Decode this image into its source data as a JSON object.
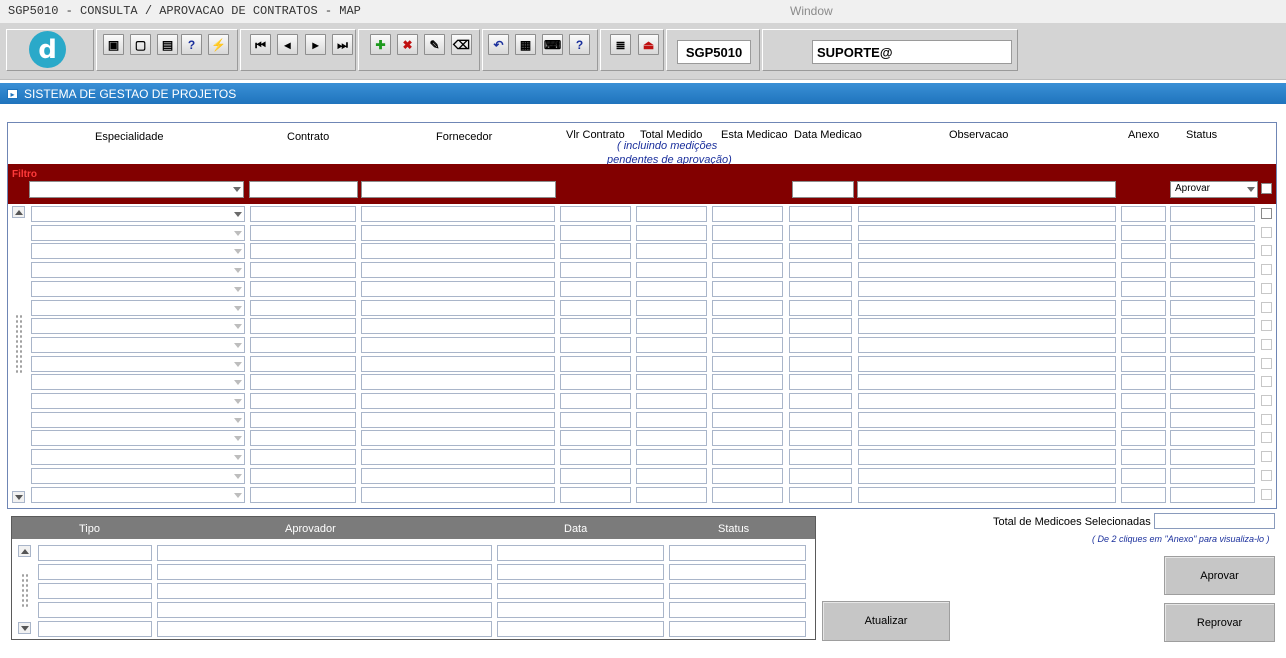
{
  "window": {
    "title": "SGP5010 - CONSULTA / APROVACAO DE CONTRATOS - MAP",
    "label": "Window"
  },
  "toolbar": {
    "form_code": "SGP5010",
    "user": "SUPORTE@",
    "logo_text": "d",
    "buttons": [
      {
        "name": "save-icon",
        "glyph": "▣"
      },
      {
        "name": "print-preview-icon",
        "glyph": "▢"
      },
      {
        "name": "print-icon",
        "glyph": "▤"
      },
      {
        "name": "query-help-icon",
        "glyph": "?"
      },
      {
        "name": "execute-query-icon",
        "glyph": "⚡"
      },
      {
        "name": "first-record-icon",
        "glyph": "⏮"
      },
      {
        "name": "previous-record-icon",
        "glyph": "◂"
      },
      {
        "name": "next-record-icon",
        "glyph": "▸"
      },
      {
        "name": "last-record-icon",
        "glyph": "⏭"
      },
      {
        "name": "insert-record-icon",
        "glyph": "✚"
      },
      {
        "name": "delete-record-icon",
        "glyph": "✖"
      },
      {
        "name": "edit-record-icon",
        "glyph": "✎"
      },
      {
        "name": "clear-record-icon",
        "glyph": "⌫"
      },
      {
        "name": "undo-icon",
        "glyph": "↶"
      },
      {
        "name": "clipboard-icon",
        "glyph": "▦"
      },
      {
        "name": "keyboard-icon",
        "glyph": "⌨"
      },
      {
        "name": "help-icon",
        "glyph": "?"
      },
      {
        "name": "menu-icon",
        "glyph": "≣"
      },
      {
        "name": "exit-icon",
        "glyph": "⏏"
      }
    ]
  },
  "section": {
    "title": "SISTEMA DE GESTAO DE PROJETOS"
  },
  "grid": {
    "columns": {
      "especialidade": "Especialidade",
      "contrato": "Contrato",
      "fornecedor": "Fornecedor",
      "vlr_contrato": "Vlr Contrato",
      "total_medido": "Total Medido",
      "total_medido_sub1": "( incluindo medições",
      "total_medido_sub2": "pendentes de aprovação)",
      "esta_medicao": "Esta Medicao",
      "data_medicao": "Data Medicao",
      "observacao": "Observacao",
      "anexo": "Anexo",
      "status": "Status"
    },
    "filter_label": "Filtro",
    "filter_status_value": "Aprovar",
    "row_count": 16
  },
  "approvals": {
    "columns": {
      "tipo": "Tipo",
      "aprovador": "Aprovador",
      "data": "Data",
      "status": "Status"
    },
    "row_count": 5
  },
  "summary": {
    "total_label": "Total de Medicoes Selecionadas",
    "hint": "( De 2 cliques em \"Anexo\" para visualiza-lo )"
  },
  "actions": {
    "atualizar": "Atualizar",
    "aprovar": "Aprovar",
    "reprovar": "Reprovar"
  },
  "colors": {
    "section_bar": "#2b83c9",
    "filter_bar": "#820000",
    "filter_label": "#ff3a3a",
    "hint_text": "#1a2f9c"
  }
}
